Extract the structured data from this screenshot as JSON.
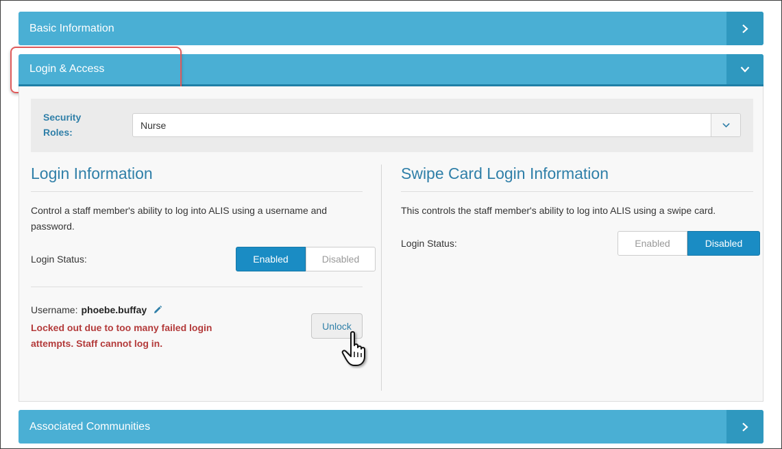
{
  "sections": {
    "basic": {
      "title": "Basic Information",
      "icon": "chevron-right-icon"
    },
    "login": {
      "title": "Login & Access",
      "icon": "chevron-down-icon"
    },
    "assoc": {
      "title": "Associated Communities",
      "icon": "chevron-right-icon"
    }
  },
  "security_roles": {
    "label_line1": "Security",
    "label_line2": "Roles:",
    "value": "Nurse"
  },
  "login_info": {
    "title": "Login Information",
    "description": "Control a staff member's ability to log into ALIS using a username and password.",
    "status_label": "Login Status:",
    "enabled_label": "Enabled",
    "disabled_label": "Disabled",
    "selected": "Enabled",
    "username_label": "Username:",
    "username": "phoebe.buffay",
    "locked_message": "Locked out due to too many failed login attempts. Staff cannot log in.",
    "unlock_label": "Unlock"
  },
  "swipe_info": {
    "title": "Swipe Card Login Information",
    "description": "This controls the staff member's ability to log into ALIS using a swipe card.",
    "status_label": "Login Status:",
    "enabled_label": "Enabled",
    "disabled_label": "Disabled",
    "selected": "Disabled"
  },
  "colors": {
    "header": "#4aafd4",
    "header_toggle": "#2f98bf",
    "accent_text": "#2f7fa8",
    "active_button": "#1a8cc4",
    "error_text": "#b33a3a",
    "highlight_box": "#e05a5a"
  }
}
